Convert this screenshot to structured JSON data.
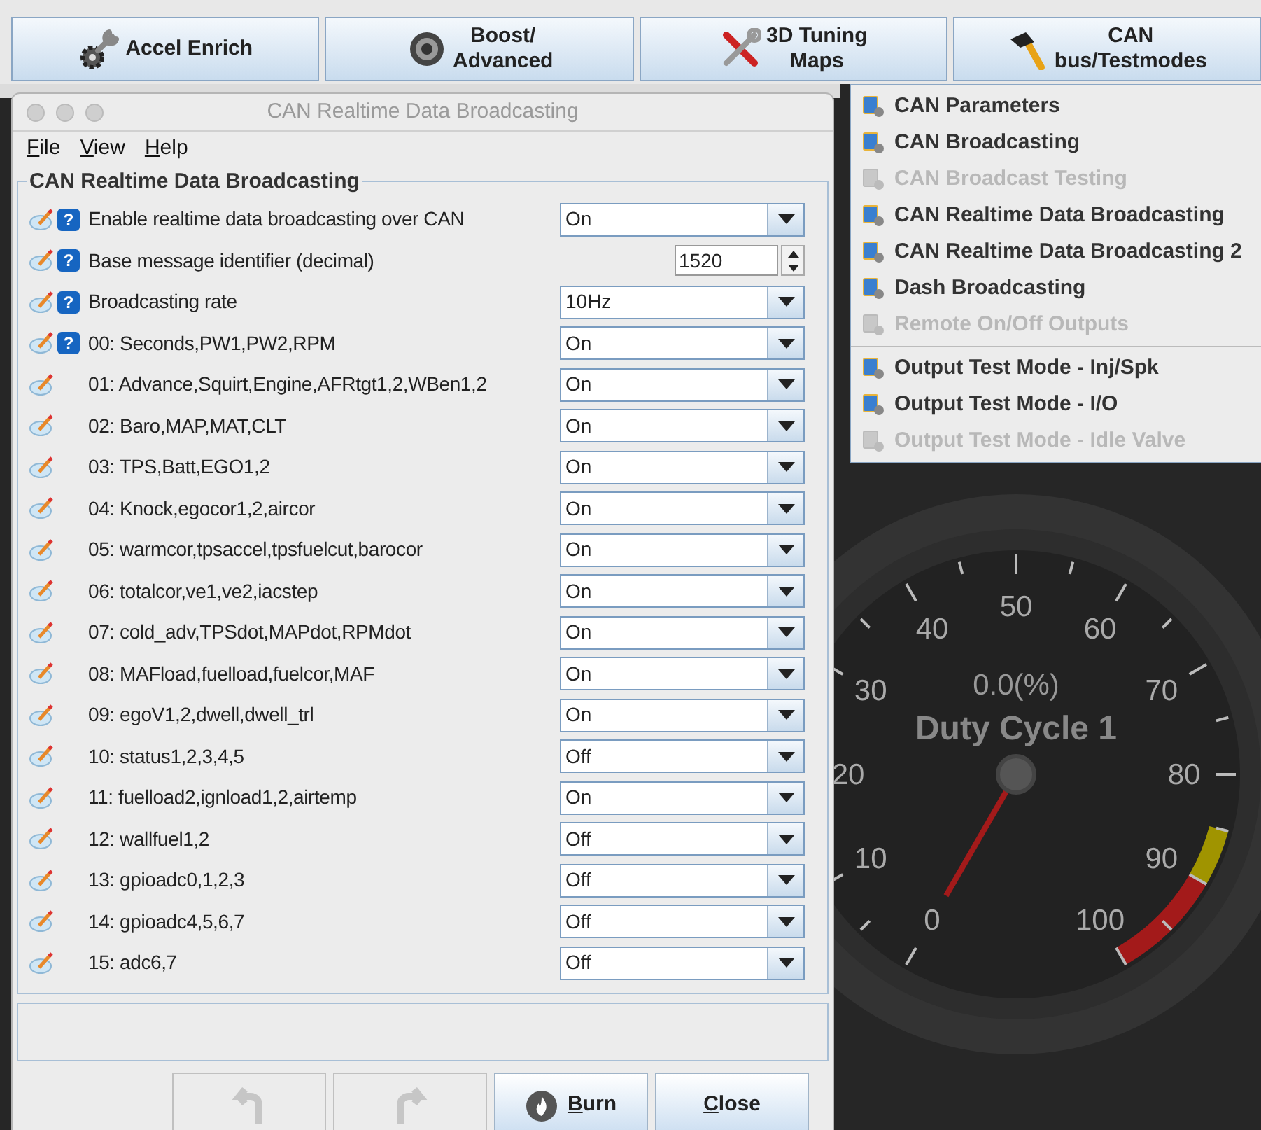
{
  "toolbar": [
    {
      "lines": [
        "Accel Enrich"
      ]
    },
    {
      "lines": [
        "Boost/",
        "Advanced"
      ]
    },
    {
      "lines": [
        "3D Tuning",
        "Maps"
      ]
    },
    {
      "lines": [
        "CAN",
        "bus/Testmodes"
      ]
    }
  ],
  "dialog": {
    "title": "CAN Realtime Data Broadcasting",
    "menus": [
      "File",
      "View",
      "Help"
    ],
    "group_title": "CAN Realtime Data Broadcasting",
    "rows": [
      {
        "label": "Enable realtime data broadcasting over CAN",
        "help": "?",
        "kind": "dropdown",
        "value": "On"
      },
      {
        "label": "Base message identifier (decimal)",
        "help": "?",
        "kind": "spinner",
        "value": "1520"
      },
      {
        "label": "Broadcasting rate",
        "help": "?",
        "kind": "dropdown",
        "value": "10Hz"
      },
      {
        "label": "00: Seconds,PW1,PW2,RPM",
        "help": "?",
        "kind": "dropdown",
        "value": "On"
      },
      {
        "label": "01: Advance,Squirt,Engine,AFRtgt1,2,WBen1,2",
        "kind": "dropdown",
        "value": "On"
      },
      {
        "label": "02: Baro,MAP,MAT,CLT",
        "kind": "dropdown",
        "value": "On"
      },
      {
        "label": "03: TPS,Batt,EGO1,2",
        "kind": "dropdown",
        "value": "On"
      },
      {
        "label": "04: Knock,egocor1,2,aircor",
        "kind": "dropdown",
        "value": "On"
      },
      {
        "label": "05: warmcor,tpsaccel,tpsfuelcut,barocor",
        "kind": "dropdown",
        "value": "On"
      },
      {
        "label": "06: totalcor,ve1,ve2,iacstep",
        "kind": "dropdown",
        "value": "On"
      },
      {
        "label": "07: cold_adv,TPSdot,MAPdot,RPMdot",
        "kind": "dropdown",
        "value": "On"
      },
      {
        "label": "08: MAFload,fuelload,fuelcor,MAF",
        "kind": "dropdown",
        "value": "On"
      },
      {
        "label": "09: egoV1,2,dwell,dwell_trl",
        "kind": "dropdown",
        "value": "On"
      },
      {
        "label": "10: status1,2,3,4,5",
        "kind": "dropdown",
        "value": "Off"
      },
      {
        "label": "11: fuelload2,ignload1,2,airtemp",
        "kind": "dropdown",
        "value": "On"
      },
      {
        "label": "12: wallfuel1,2",
        "kind": "dropdown",
        "value": "Off"
      },
      {
        "label": "13: gpioadc0,1,2,3",
        "kind": "dropdown",
        "value": "Off"
      },
      {
        "label": "14: gpioadc4,5,6,7",
        "kind": "dropdown",
        "value": "Off"
      },
      {
        "label": "15: adc6,7",
        "kind": "dropdown",
        "value": "Off"
      }
    ],
    "buttons": [
      {
        "kind": "undo",
        "disabled": true
      },
      {
        "kind": "redo",
        "disabled": true
      },
      {
        "kind": "burn",
        "label": "Burn",
        "disabled": false
      },
      {
        "kind": "close",
        "label": "Close",
        "disabled": false
      }
    ]
  },
  "menu": {
    "groups": [
      [
        {
          "label": "CAN Parameters",
          "disabled": false
        },
        {
          "label": "CAN Broadcasting",
          "disabled": false
        },
        {
          "label": "CAN Broadcast Testing",
          "disabled": true
        },
        {
          "label": "CAN Realtime Data Broadcasting",
          "disabled": false
        },
        {
          "label": "CAN Realtime Data Broadcasting 2",
          "disabled": false
        },
        {
          "label": "Dash Broadcasting",
          "disabled": false
        },
        {
          "label": "Remote On/Off Outputs",
          "disabled": true
        }
      ],
      [
        {
          "label": "Output Test Mode - Inj/Spk",
          "disabled": false
        },
        {
          "label": "Output Test Mode - I/O",
          "disabled": false
        },
        {
          "label": "Output Test Mode - Idle Valve",
          "disabled": true
        }
      ]
    ]
  },
  "gauge": {
    "reading": "0.0(%)",
    "title": "Duty Cycle 1",
    "scale": [
      "0",
      "10",
      "20",
      "30",
      "40",
      "50",
      "60",
      "70",
      "80",
      "90",
      "100"
    ]
  }
}
